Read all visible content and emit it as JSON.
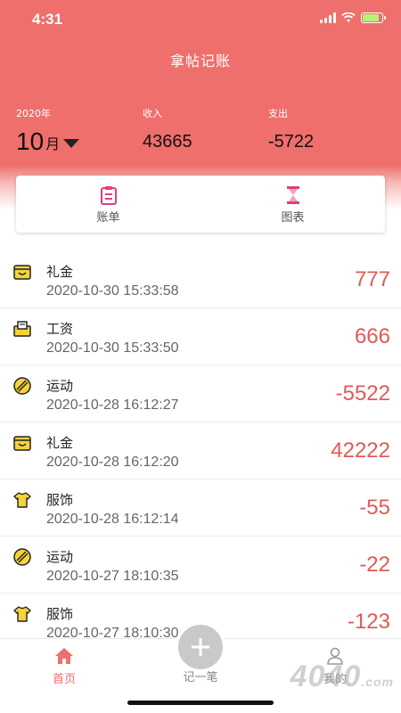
{
  "status_bar": {
    "time": "4:31"
  },
  "app": {
    "title": "拿帖记账"
  },
  "summary": {
    "year_label": "2020年",
    "month_number": "10",
    "month_unit": "月",
    "income_label": "收入",
    "income_value": "43665",
    "expense_label": "支出",
    "expense_value": "-5722"
  },
  "tabs": [
    {
      "label": "账单",
      "icon": "ledger-icon"
    },
    {
      "label": "图表",
      "icon": "hourglass-icon"
    }
  ],
  "records": [
    {
      "category": "礼金",
      "time": "2020-10-30 15:33:58",
      "amount": "777",
      "icon": "gift-box-icon"
    },
    {
      "category": "工资",
      "time": "2020-10-30 15:33:50",
      "amount": "666",
      "icon": "salary-icon"
    },
    {
      "category": "运动",
      "time": "2020-10-28 16:12:27",
      "amount": "-5522",
      "icon": "sport-icon"
    },
    {
      "category": "礼金",
      "time": "2020-10-28 16:12:20",
      "amount": "42222",
      "icon": "gift-box-icon"
    },
    {
      "category": "服饰",
      "time": "2020-10-28 16:12:14",
      "amount": "-55",
      "icon": "shirt-icon"
    },
    {
      "category": "运动",
      "time": "2020-10-27 18:10:35",
      "amount": "-22",
      "icon": "sport-icon"
    },
    {
      "category": "服饰",
      "time": "2020-10-27 18:10:30",
      "amount": "-123",
      "icon": "shirt-icon"
    }
  ],
  "tabbar": {
    "home_label": "首页",
    "add_label": "记一笔",
    "mine_label": "我的"
  },
  "watermark": {
    "text": "4040",
    "suffix": ".com"
  },
  "colors": {
    "accent": "#ef6f6c",
    "amount": "#e05a55",
    "icon_yellow": "#f5d23a"
  }
}
